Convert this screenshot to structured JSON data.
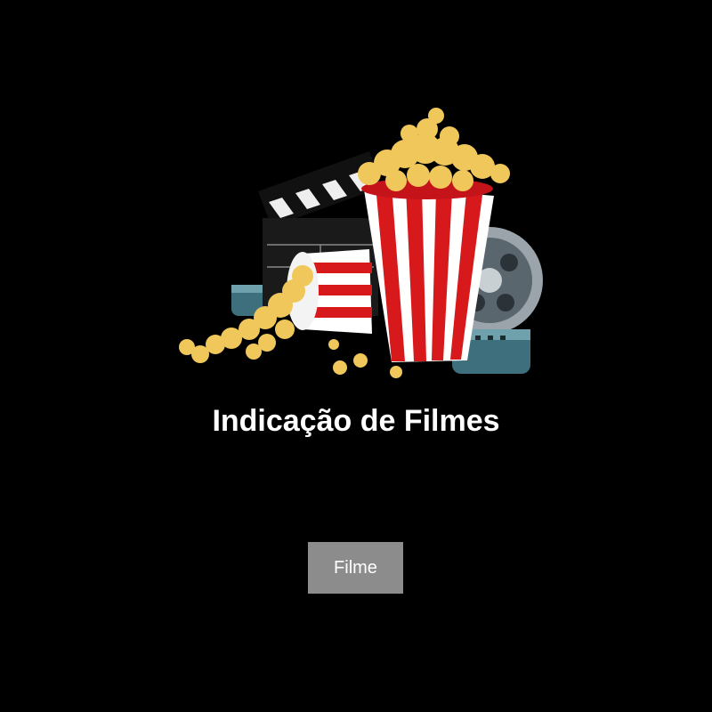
{
  "main": {
    "title": "Indicação de Filmes",
    "hero_image": "popcorn-clapperboard-film-reel-illustration",
    "button_label": "Filme"
  },
  "colors": {
    "background": "#000000",
    "title_text": "#ffffff",
    "button_background": "#8c8c8c",
    "button_text": "#ffffff",
    "stripe_red": "#d7191c",
    "popcorn": "#f0c75a"
  }
}
